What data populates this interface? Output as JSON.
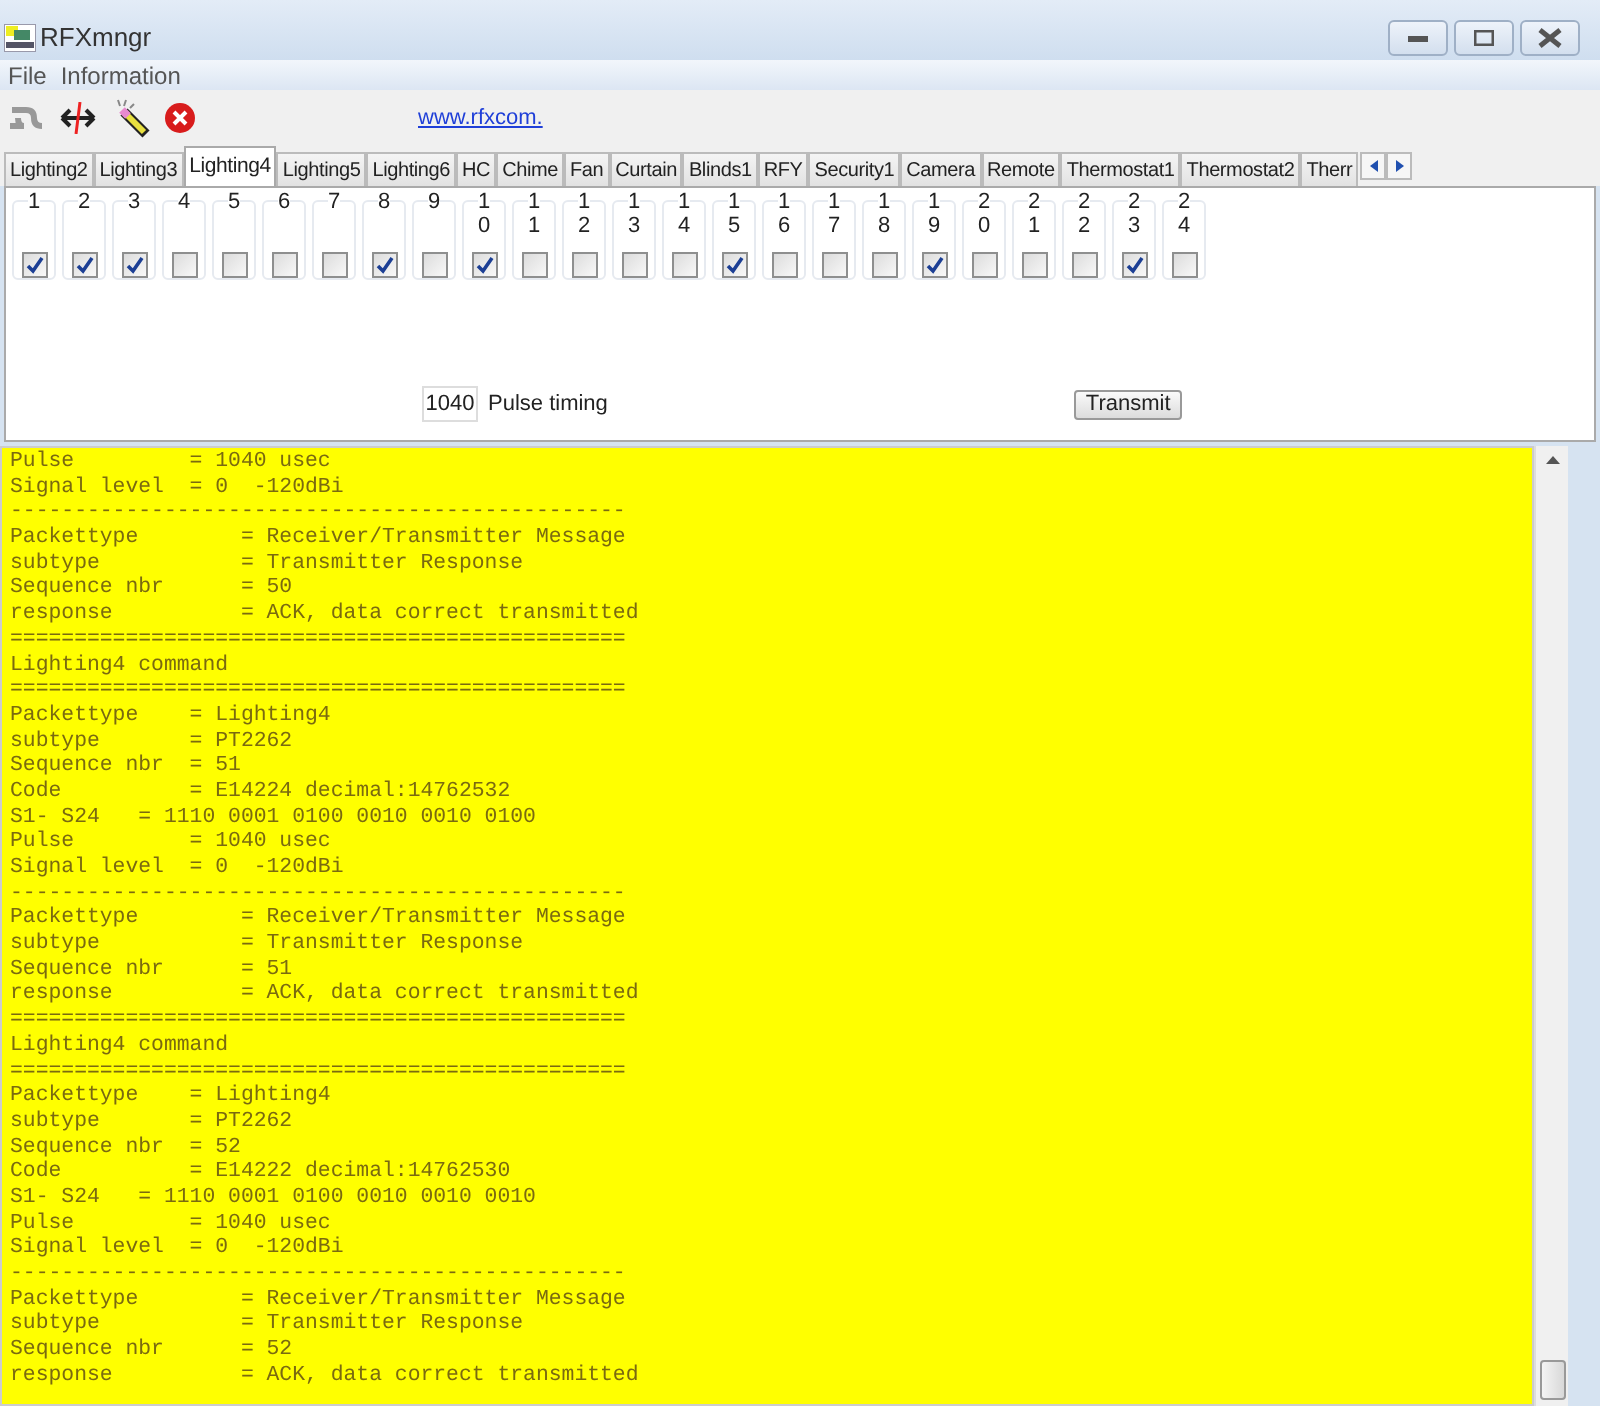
{
  "window": {
    "title": "RFXmngr"
  },
  "menu": [
    "File",
    "Information"
  ],
  "toolbar": {
    "link": "www.rfxcom."
  },
  "tabs": [
    {
      "label": "Lighting2",
      "selected": false
    },
    {
      "label": "Lighting3",
      "selected": false
    },
    {
      "label": "Lighting4",
      "selected": true
    },
    {
      "label": "Lighting5",
      "selected": false
    },
    {
      "label": "Lighting6",
      "selected": false
    },
    {
      "label": "HC",
      "selected": false
    },
    {
      "label": "Chime",
      "selected": false
    },
    {
      "label": "Fan",
      "selected": false
    },
    {
      "label": "Curtain",
      "selected": false
    },
    {
      "label": "Blinds1",
      "selected": false
    },
    {
      "label": "RFY",
      "selected": false
    },
    {
      "label": "Security1",
      "selected": false
    },
    {
      "label": "Camera",
      "selected": false
    },
    {
      "label": "Remote",
      "selected": false
    },
    {
      "label": "Thermostat1",
      "selected": false
    },
    {
      "label": "Thermostat2",
      "selected": false
    },
    {
      "label": "Therr",
      "selected": false
    }
  ],
  "switches": [
    {
      "label": "1",
      "checked": true
    },
    {
      "label": "2",
      "checked": true
    },
    {
      "label": "3",
      "checked": true
    },
    {
      "label": "4",
      "checked": false
    },
    {
      "label": "5",
      "checked": false
    },
    {
      "label": "6",
      "checked": false
    },
    {
      "label": "7",
      "checked": false
    },
    {
      "label": "8",
      "checked": true
    },
    {
      "label": "9",
      "checked": false
    },
    {
      "label": "10",
      "checked": true
    },
    {
      "label": "11",
      "checked": false
    },
    {
      "label": "12",
      "checked": false
    },
    {
      "label": "13",
      "checked": false
    },
    {
      "label": "14",
      "checked": false
    },
    {
      "label": "15",
      "checked": true
    },
    {
      "label": "16",
      "checked": false
    },
    {
      "label": "17",
      "checked": false
    },
    {
      "label": "18",
      "checked": false
    },
    {
      "label": "19",
      "checked": true
    },
    {
      "label": "20",
      "checked": false
    },
    {
      "label": "21",
      "checked": false
    },
    {
      "label": "22",
      "checked": false
    },
    {
      "label": "23",
      "checked": true
    },
    {
      "label": "24",
      "checked": false
    }
  ],
  "pulse": {
    "value": "1040",
    "label": "Pulse timing"
  },
  "transmit_button": "Transmit",
  "log": [
    "Pulse         = 1040 usec",
    "Signal level  = 0  -120dBi",
    "------------------------------------------------",
    "Packettype        = Receiver/Transmitter Message",
    "subtype           = Transmitter Response",
    "Sequence nbr      = 50",
    "response          = ACK, data correct transmitted",
    "================================================",
    "Lighting4 command",
    "================================================",
    "Packettype    = Lighting4",
    "subtype       = PT2262",
    "Sequence nbr  = 51",
    "Code          = E14224 decimal:14762532",
    "S1- S24   = 1110 0001 0100 0010 0010 0100",
    "Pulse         = 1040 usec",
    "Signal level  = 0  -120dBi",
    "------------------------------------------------",
    "Packettype        = Receiver/Transmitter Message",
    "subtype           = Transmitter Response",
    "Sequence nbr      = 51",
    "response          = ACK, data correct transmitted",
    "================================================",
    "Lighting4 command",
    "================================================",
    "Packettype    = Lighting4",
    "subtype       = PT2262",
    "Sequence nbr  = 52",
    "Code          = E14222 decimal:14762530",
    "S1- S24   = 1110 0001 0100 0010 0010 0010",
    "Pulse         = 1040 usec",
    "Signal level  = 0  -120dBi",
    "------------------------------------------------",
    "Packettype        = Receiver/Transmitter Message",
    "subtype           = Transmitter Response",
    "Sequence nbr      = 52",
    "response          = ACK, data correct transmitted"
  ]
}
